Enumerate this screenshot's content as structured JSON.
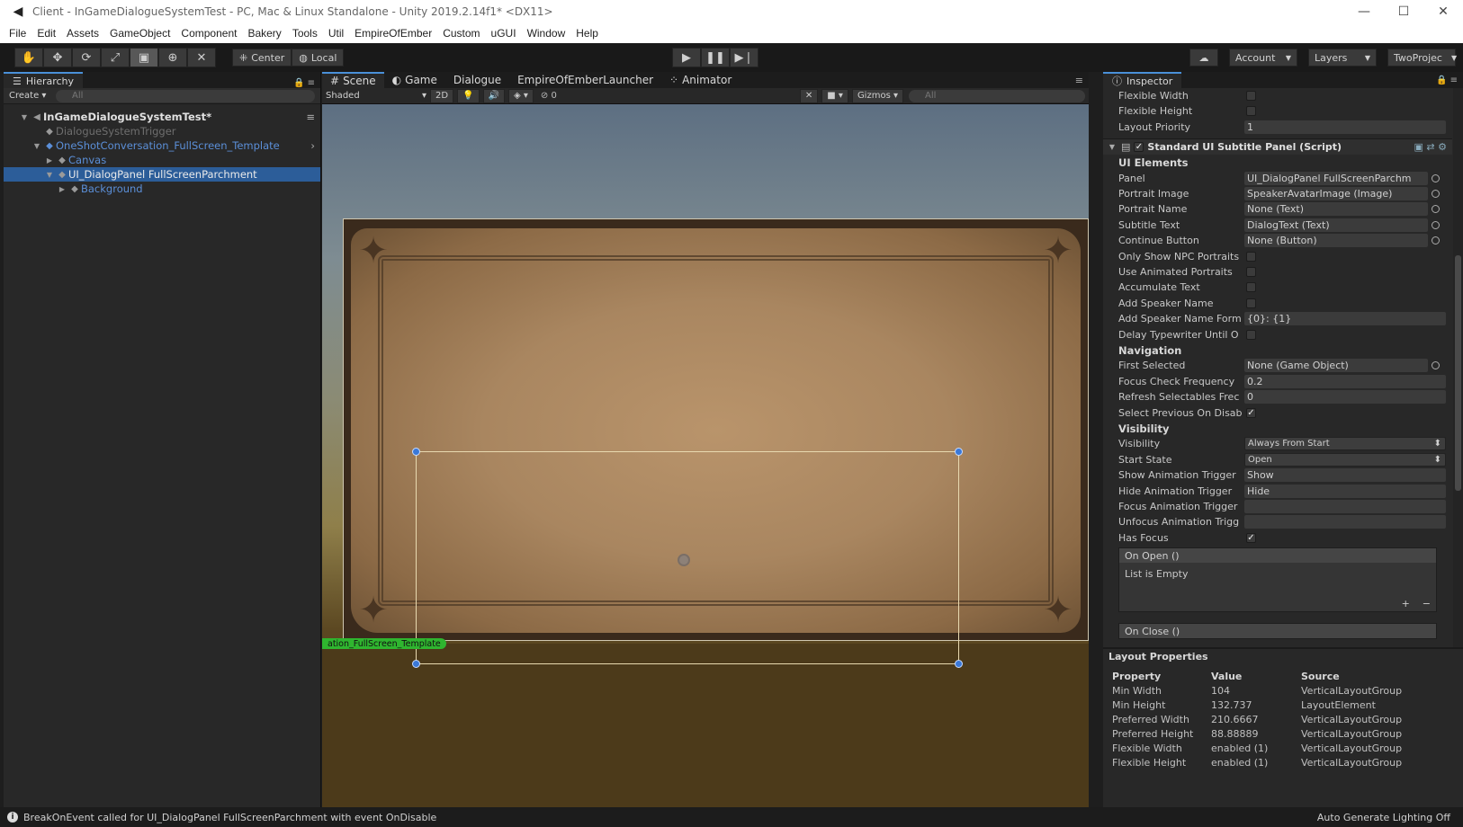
{
  "window": {
    "title": "Client - InGameDialogueSystemTest - PC, Mac & Linux Standalone - Unity 2019.2.14f1* <DX11>",
    "controls": [
      "—",
      "☐",
      "✕"
    ]
  },
  "menu": [
    "File",
    "Edit",
    "Assets",
    "GameObject",
    "Component",
    "Bakery",
    "Tools",
    "Util",
    "EmpireOfEmber",
    "Custom",
    "uGUI",
    "Window",
    "Help"
  ],
  "toolbar": {
    "pivot": "Center",
    "space": "Local",
    "account": "Account",
    "layers": "Layers",
    "layout": "TwoProjec"
  },
  "hierarchy": {
    "tab": "Hierarchy",
    "create": "Create",
    "search_placeholder": "All",
    "scene_name": "InGameDialogueSystemTest*",
    "items": [
      "DialogueSystemTrigger",
      "OneShotConversation_FullScreen_Template",
      "Canvas",
      "UI_DialogPanel FullScreenParchment",
      "Background"
    ]
  },
  "scene": {
    "tabs": [
      "Scene",
      "Game",
      "Dialogue",
      "EmpireOfEmberLauncher",
      "Animator"
    ],
    "shading": "Shaded",
    "mode_2d": "2D",
    "hidden_count": "0",
    "gizmos": "Gizmos",
    "search_placeholder": "All",
    "object_label": "ation_FullScreen_Template"
  },
  "inspector": {
    "tab": "Inspector",
    "top_rows": [
      {
        "label": "Flexible Width",
        "type": "checkbox",
        "checked": false
      },
      {
        "label": "Flexible Height",
        "type": "checkbox",
        "checked": false
      },
      {
        "label": "Layout Priority",
        "type": "field",
        "value": "1"
      }
    ],
    "component_title": "Standard UI Subtitle Panel (Script)",
    "sections": {
      "ui_elements": "UI Elements",
      "navigation": "Navigation",
      "visibility": "Visibility"
    },
    "ui_rows": [
      {
        "label": "Panel",
        "value": "UI_DialogPanel FullScreenParchm",
        "type": "object"
      },
      {
        "label": "Portrait Image",
        "value": "SpeakerAvatarImage (Image)",
        "type": "object"
      },
      {
        "label": "Portrait Name",
        "value": "None (Text)",
        "type": "object"
      },
      {
        "label": "Subtitle Text",
        "value": "DialogText (Text)",
        "type": "object"
      },
      {
        "label": "Continue Button",
        "value": "None (Button)",
        "type": "object"
      },
      {
        "label": "Only Show NPC Portraits",
        "type": "checkbox",
        "checked": false
      },
      {
        "label": "Use Animated Portraits",
        "type": "checkbox",
        "checked": false
      },
      {
        "label": "Accumulate Text",
        "type": "checkbox",
        "checked": false
      },
      {
        "label": "Add Speaker Name",
        "type": "checkbox",
        "checked": false
      },
      {
        "label": "Add Speaker Name Form",
        "value": "{0}: {1}",
        "type": "field"
      },
      {
        "label": "Delay Typewriter Until O",
        "type": "checkbox",
        "checked": false
      }
    ],
    "nav_rows": [
      {
        "label": "First Selected",
        "value": "None (Game Object)",
        "type": "object"
      },
      {
        "label": "Focus Check Frequency",
        "value": "0.2",
        "type": "field"
      },
      {
        "label": "Refresh Selectables Frec",
        "value": "0",
        "type": "field"
      },
      {
        "label": "Select Previous On Disab",
        "type": "checkbox",
        "checked": true
      }
    ],
    "vis_rows": [
      {
        "label": "Visibility",
        "value": "Always From Start",
        "type": "select"
      },
      {
        "label": "Start State",
        "value": "Open",
        "type": "select"
      },
      {
        "label": "Show Animation Trigger",
        "value": "Show",
        "type": "field"
      },
      {
        "label": "Hide Animation Trigger",
        "value": "Hide",
        "type": "field"
      },
      {
        "label": "Focus Animation Trigger",
        "value": "",
        "type": "field"
      },
      {
        "label": "Unfocus Animation Trigg",
        "value": "",
        "type": "field"
      },
      {
        "label": "Has Focus",
        "type": "checkbox",
        "checked": true
      }
    ],
    "on_open": "On Open ()",
    "list_empty": "List is Empty",
    "on_close": "On Close ()",
    "plus": "+",
    "minus": "−"
  },
  "layout_properties": {
    "title": "Layout Properties",
    "headers": [
      "Property",
      "Value",
      "Source"
    ],
    "rows": [
      [
        "Min Width",
        "104",
        "VerticalLayoutGroup"
      ],
      [
        "Min Height",
        "132.737",
        "LayoutElement"
      ],
      [
        "Preferred Width",
        "210.6667",
        "VerticalLayoutGroup"
      ],
      [
        "Preferred Height",
        "88.88889",
        "VerticalLayoutGroup"
      ],
      [
        "Flexible Width",
        "enabled (1)",
        "VerticalLayoutGroup"
      ],
      [
        "Flexible Height",
        "enabled (1)",
        "VerticalLayoutGroup"
      ]
    ]
  },
  "status": {
    "message": "BreakOnEvent called for UI_DialogPanel FullScreenParchment with event OnDisable",
    "right": "Auto Generate Lighting Off"
  },
  "colors": {
    "selection": "#2c5d99",
    "prefab_blue": "#5b8fd8",
    "handle_blue": "#3a78d8",
    "label_green": "#2fb52f"
  }
}
